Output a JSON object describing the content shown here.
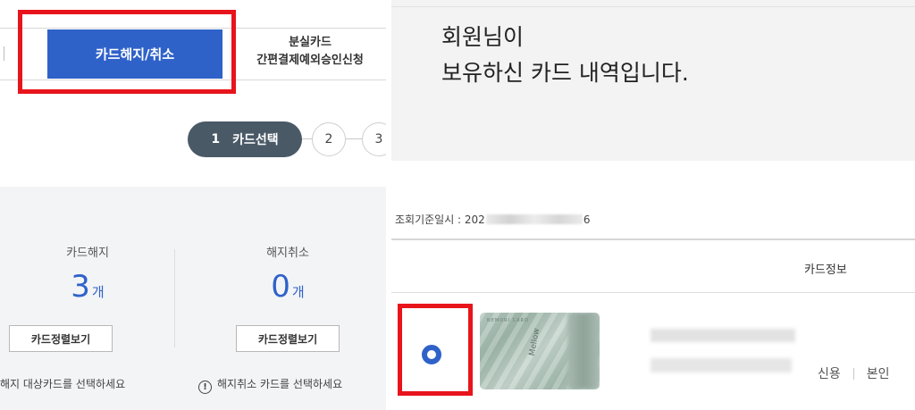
{
  "tabs": {
    "active_label": "카드해지/취소",
    "lost_line1": "분실카드",
    "lost_line2": "간편결제예외승인신청"
  },
  "steps": [
    {
      "number": "1",
      "label": "카드선택"
    },
    {
      "number": "2"
    },
    {
      "number": "3"
    }
  ],
  "summary": {
    "cancel": {
      "label": "카드해지",
      "count": "3",
      "unit": "개",
      "button": "카드정렬보기",
      "hint": "해지 대상카드를 선택하세요"
    },
    "revoke": {
      "label": "해지취소",
      "count": "0",
      "unit": "개",
      "button": "카드정렬보기",
      "hint": "해지취소 카드를 선택하세요"
    }
  },
  "right": {
    "welcome_line1": "회원님이",
    "welcome_line2": "보유하신 카드 내역입니다.",
    "query_prefix": "조회기준일시 : 202",
    "query_suffix": "6",
    "column_header": "카드정보",
    "card": {
      "brand": "NEMORI CARD",
      "tag_credit": "신용",
      "tag_owner": "본인"
    }
  },
  "colors": {
    "accent": "#2f62c9",
    "highlight": "#e8141c",
    "stepper_active": "#4a5966"
  },
  "icons": {
    "info": "info-circle-icon"
  }
}
